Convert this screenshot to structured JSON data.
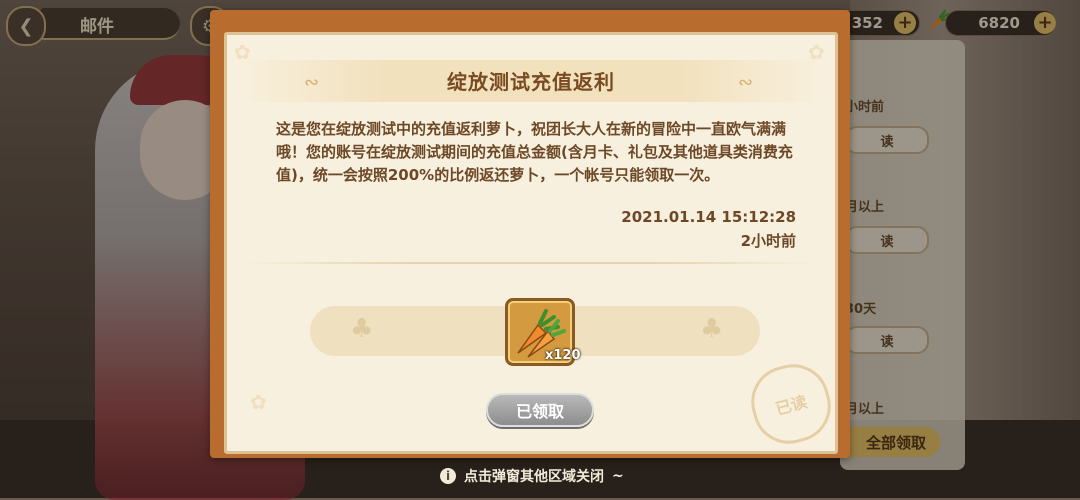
{
  "top_bar": {
    "title": "邮件",
    "resource_1_value": "352",
    "resource_2_value": "6820"
  },
  "background_list": {
    "tags": [
      "小时前",
      "月以上",
      "30天",
      "月以上"
    ],
    "item_label": "读",
    "claim_all": "全部领取"
  },
  "dialog": {
    "title": "绽放测试充值返利",
    "body": "这是您在绽放测试中的充值返利萝卜，祝团长大人在新的冒险中一直欧气满满哦！您的账号在绽放测试期间的充值总金额(含月卡、礼包及其他道具类消费充值)，统一会按照200%的比例返还萝卜，一个帐号只能领取一次。",
    "date": "2021.01.14 15:12:28",
    "time_ago": "2小时前",
    "reward": {
      "icon": "carrot-icon",
      "quantity": "x120"
    },
    "claimed_button": "已领取",
    "stamp": "已读"
  },
  "hint": "点击弹窗其他区域关闭",
  "colors": {
    "frame": "#b86d2f",
    "panel": "#f8f0de",
    "title": "#7a4a22",
    "text": "#6d4827"
  }
}
